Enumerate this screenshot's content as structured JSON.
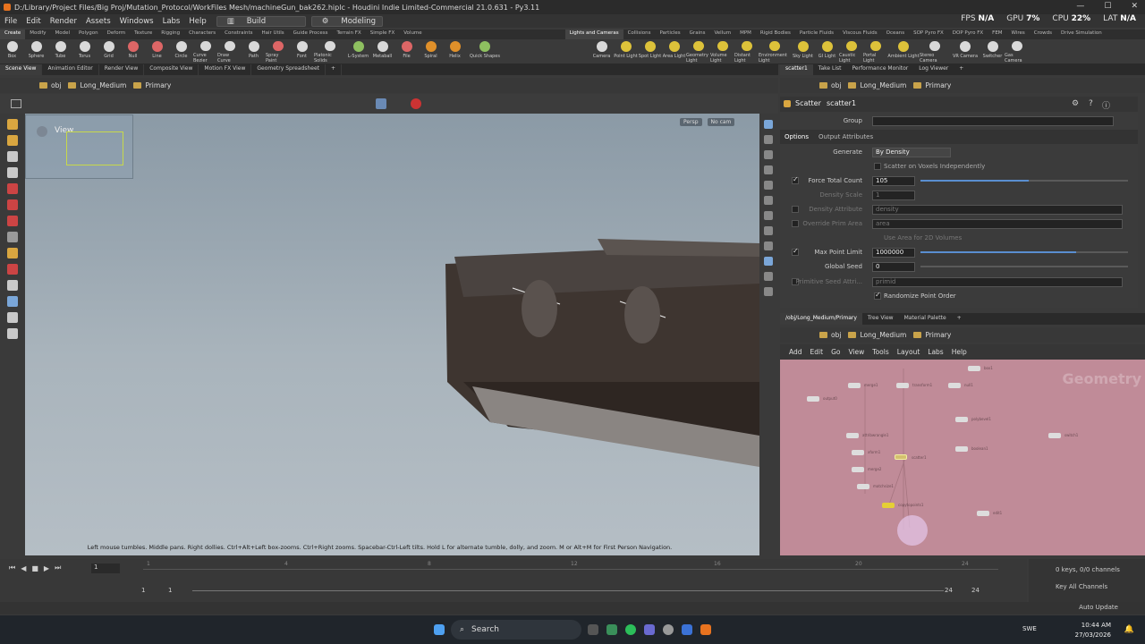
{
  "window": {
    "title": "D:/Library/Project Files/Big Proj/Mutation_Protocol/WorkFiles Mesh/machineGun_bak262.hiplc - Houdini Indie Limited-Commercial 21.0.631 - Py3.11"
  },
  "menu": {
    "items": [
      "File",
      "Edit",
      "Render",
      "Assets",
      "Windows",
      "Labs",
      "Help"
    ],
    "desk_build": "Build",
    "desk_modeling": "Modeling"
  },
  "hud": {
    "fps_label": "FPS",
    "fps_value": "N/A",
    "gpu_label": "GPU",
    "gpu_value": "7%",
    "cpu_label": "CPU",
    "cpu_value": "22%",
    "lat_label": "LAT",
    "lat_value": "N/A"
  },
  "shelf": {
    "tabs": [
      "Create",
      "Modify",
      "Model",
      "Polygon",
      "Deform",
      "Texture",
      "Rigging",
      "Characters",
      "Constraints",
      "Hair Utils",
      "Guide Process",
      "Terrain FX",
      "Simple FX",
      "Volume"
    ],
    "tabs_right": [
      "Lights and Cameras",
      "Collisions",
      "Particles",
      "Grains",
      "Vellum",
      "MPM",
      "Rigid Bodies",
      "Particle Fluids",
      "Viscous Fluids",
      "Oceans",
      "SOP Pyro FX",
      "DOP Pyro FX",
      "FEM",
      "Wires",
      "Crowds",
      "Drive Simulation"
    ],
    "tools": [
      "Box",
      "Sphere",
      "Tube",
      "Torus",
      "Grid",
      "Null",
      "Line",
      "Circle",
      "Curve Bezier",
      "Draw Curve",
      "Path",
      "Spray Paint",
      "Font",
      "Platonic Solids",
      "L-System",
      "Metaball",
      "File",
      "Spiral",
      "Helix",
      "Quick Shapes"
    ],
    "tools_right": [
      "Camera",
      "Point Light",
      "Spot Light",
      "Area Light",
      "Geometry Light",
      "Volume Light",
      "Distant Light",
      "Environment Light",
      "Sky Light",
      "GI Light",
      "Caustic Light",
      "Portal Light",
      "Ambient Light",
      "Stereo Camera",
      "VR Camera",
      "Switcher",
      "Gas Camera"
    ]
  },
  "pane_tabs": [
    "Scene View",
    "Animation Editor",
    "Render View",
    "Composite View",
    "Motion FX View",
    "Geometry Spreadsheet"
  ],
  "pane_tabs_right": [
    "scatter1",
    "Take List",
    "Performance Monitor",
    "Log Viewer"
  ],
  "path": {
    "obj": "obj",
    "node": "Long_Medium",
    "sub": "Primary"
  },
  "viewport": {
    "view_label": "View",
    "persp": "Persp",
    "cam": "No cam",
    "hint": "Left mouse tumbles. Middle pans. Right dollies. Ctrl+Alt+Left box-zooms. Ctrl+Right zooms. Spacebar-Ctrl-Left tilts. Hold L for alternate tumble, dolly, and zoom. M or Alt+M for First Person Navigation."
  },
  "params": {
    "node_type": "Scatter",
    "node_name": "scatter1",
    "group_label": "Group",
    "tab_options": "Options",
    "tab_output": "Output Attributes",
    "generate_label": "Generate",
    "generate_value": "By Density",
    "scatter_voxels": "Scatter on Voxels Independently",
    "force_total_label": "Force Total Count",
    "force_total_value": "105",
    "force_total_frac": 0.52,
    "density_scale_label": "Density Scale",
    "density_scale_value": "1",
    "density_attr_label": "Density Attribute",
    "density_attr_value": "density",
    "override_area_label": "Override Prim Area",
    "override_area_value": "area",
    "use_area_label": "Use Area for 2D Volumes",
    "max_point_label": "Max Point Limit",
    "max_point_value": "1000000",
    "max_point_frac": 0.75,
    "global_seed_label": "Global Seed",
    "global_seed_value": "0",
    "prim_seed_label": "Primitive Seed Attri...",
    "prim_seed_value": "primid",
    "randomize_label": "Randomize Point Order"
  },
  "network": {
    "tabs": [
      "/obj/Long_Medium/Primary",
      "Tree View",
      "Material Palette"
    ],
    "path_obj": "obj",
    "path_node": "Long_Medium",
    "path_sub": "Primary",
    "menu": [
      "Add",
      "Edit",
      "Go",
      "View",
      "Tools",
      "Layout",
      "Labs",
      "Help"
    ],
    "watermark": "Geometry",
    "nodes": [
      {
        "label": "output0"
      },
      {
        "label": "scatter1"
      },
      {
        "label": "copytopoints1"
      },
      {
        "label": "merge1"
      },
      {
        "label": "transform1"
      },
      {
        "label": "null1"
      },
      {
        "label": "box1"
      },
      {
        "label": "polybevel1"
      },
      {
        "label": "boolean1"
      },
      {
        "label": "attribwrangle1"
      },
      {
        "label": "xform1"
      },
      {
        "label": "merge2"
      },
      {
        "label": "matchsize1"
      },
      {
        "label": "switch1"
      },
      {
        "label": "edit1"
      }
    ]
  },
  "timeline": {
    "start": "1",
    "end": "24",
    "current": "1",
    "frame_field": "1",
    "range_start": "1",
    "range_end": "24",
    "ticks": [
      "1",
      "4",
      "8",
      "12",
      "16",
      "20",
      "24"
    ],
    "keys": "0 keys, 0/0 channels",
    "key_all": "Key All Channels",
    "auto_update": "Auto Update"
  },
  "taskbar": {
    "search": "Search",
    "lang": "SWE",
    "time": "10:44 AM",
    "date": "27/03/2026"
  }
}
